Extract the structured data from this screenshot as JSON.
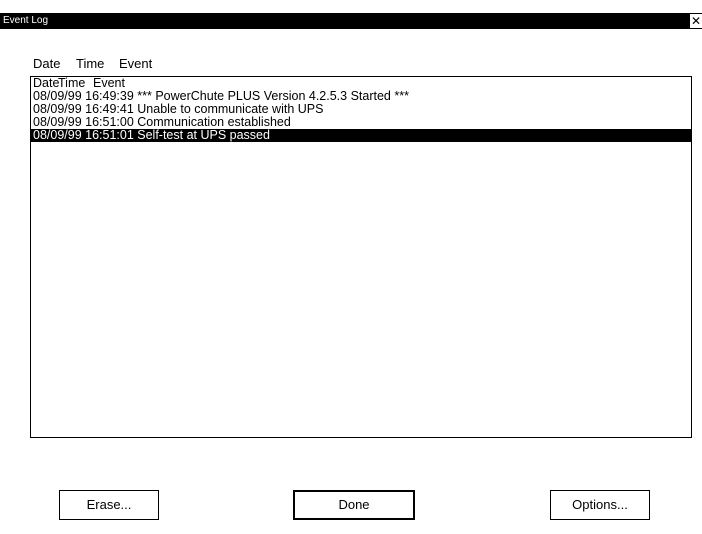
{
  "window": {
    "title": "Event Log",
    "close_glyph": "✕"
  },
  "columns": {
    "date": "Date",
    "time": "Time",
    "event": "Event"
  },
  "list": {
    "header": {
      "date": "Date",
      "time": "Time",
      "event": "Event"
    },
    "rows": [
      "08/09/99 16:49:39 *** PowerChute PLUS Version 4.2.5.3 Started ***",
      "08/09/99 16:49:41 Unable to communicate with UPS",
      "08/09/99 16:51:00 Communication established",
      "08/09/99 16:51:01 Self-test at UPS passed"
    ],
    "selected_index": 3
  },
  "buttons": {
    "erase": "Erase...",
    "done": "Done",
    "options": "Options..."
  }
}
